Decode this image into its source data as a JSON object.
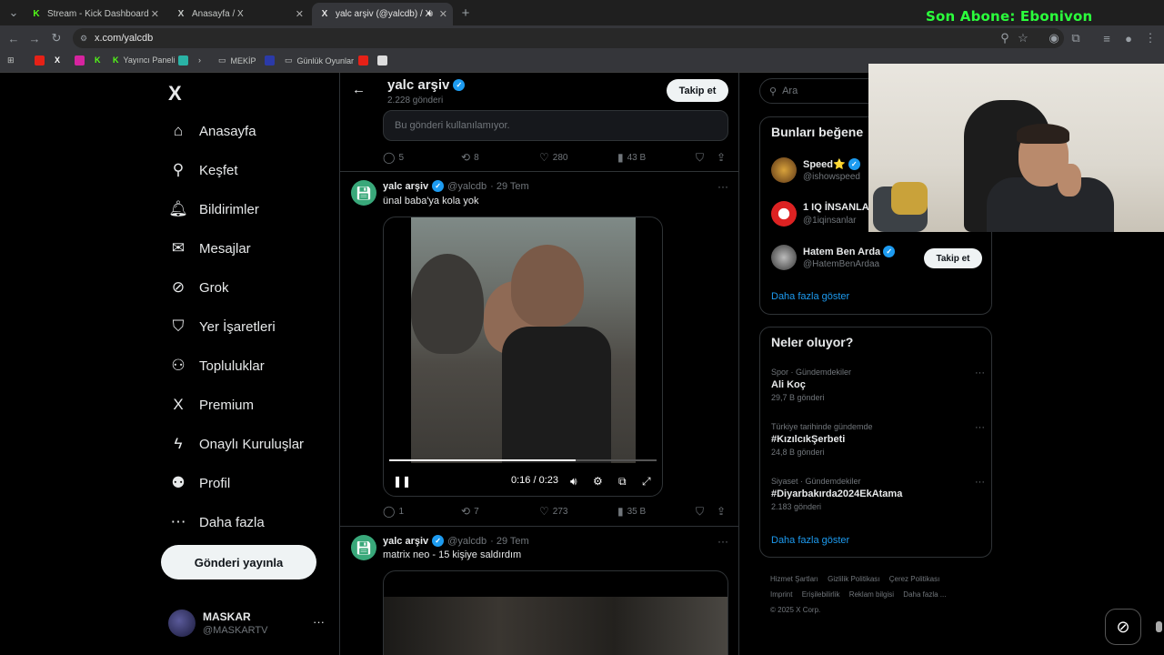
{
  "browser": {
    "tabs": [
      {
        "title": "Stream - Kick Dashboard",
        "icon": "kick-icon"
      },
      {
        "title": "Anasayfa / X",
        "icon": "x-icon"
      },
      {
        "title": "yalc arşiv (@yalcdb) / X",
        "icon": "x-icon"
      }
    ],
    "url": "x.com/yalcdb",
    "bookmarks": [
      "Yayıncı Paneli",
      "MEKİP",
      "Günlük Oyunlar"
    ],
    "overlay_text": "Son Abone: Ebonivon"
  },
  "nav": {
    "logo": "X",
    "items": [
      {
        "label": "Anasayfa",
        "icon": "home-icon",
        "glyph": "⌂"
      },
      {
        "label": "Keşfet",
        "icon": "search-icon",
        "glyph": "⚲"
      },
      {
        "label": "Bildirimler",
        "icon": "bell-icon",
        "glyph": "🔔︎"
      },
      {
        "label": "Mesajlar",
        "icon": "mail-icon",
        "glyph": "✉"
      },
      {
        "label": "Grok",
        "icon": "grok-icon",
        "glyph": "⊘"
      },
      {
        "label": "Yer İşaretleri",
        "icon": "bookmark-icon",
        "glyph": "⛉"
      },
      {
        "label": "Topluluklar",
        "icon": "communities-icon",
        "glyph": "⚇"
      },
      {
        "label": "Premium",
        "icon": "x-icon",
        "glyph": "X"
      },
      {
        "label": "Onaylı Kuruluşlar",
        "icon": "lightning-icon",
        "glyph": "ϟ"
      },
      {
        "label": "Profil",
        "icon": "profile-icon",
        "glyph": "⚉"
      },
      {
        "label": "Daha fazla",
        "icon": "more-circle-icon",
        "glyph": "⋯"
      }
    ],
    "post_button": "Gönderi yayınla",
    "account": {
      "name": "MASKAR",
      "handle": "@MASKARTV"
    }
  },
  "profile_header": {
    "name": "yalc arşiv",
    "posts": "2.228 gönderi",
    "follow": "Takip et"
  },
  "posts": [
    {
      "unavailable": "Bu gönderi kullanılamıyor.",
      "replies": "5",
      "reposts": "8",
      "likes": "280",
      "views": "43 B"
    },
    {
      "name": "yalc arşiv",
      "handle": "@yalcdb",
      "date": "· 29 Tem",
      "text": "ünal baba'ya kola yok",
      "video_time": "0:16 / 0:23",
      "progress": 0.696,
      "replies": "1",
      "reposts": "7",
      "likes": "273",
      "views": "35 B"
    },
    {
      "name": "yalc arşiv",
      "handle": "@yalcdb",
      "date": "· 29 Tem",
      "text": "matrix neo - 15 kişiye saldırdım"
    }
  ],
  "right": {
    "search_placeholder": "Ara",
    "who_title": "Bunları beğene",
    "who": [
      {
        "name": "Speed⭐",
        "handle": "@ishowspeed",
        "verified": true
      },
      {
        "name": "1 IQ İNSANLA",
        "handle": "@1iqinsanlar",
        "verified": false
      },
      {
        "name": "Hatem Ben Arda",
        "handle": "@HatemBenArdaa",
        "verified": true,
        "follow": "Takip et"
      }
    ],
    "who_more": "Daha fazla göster",
    "trends_title": "Neler oluyor?",
    "trends": [
      {
        "context": "Spor · Gündemdekiler",
        "name": "Ali Koç",
        "posts": "29,7 B gönderi"
      },
      {
        "context": "Türkiye tarihinde gündemde",
        "name": "#KızılcıkŞerbeti",
        "posts": "24,8 B gönderi"
      },
      {
        "context": "Siyaset · Gündemdekiler",
        "name": "#Diyarbakırda2024EkAtama",
        "posts": "2.183 gönderi"
      }
    ],
    "trends_more": "Daha fazla göster",
    "footer": [
      "Hizmet Şartları",
      "Gizlilik Politikası",
      "Çerez Politikası",
      "Imprint",
      "Erişilebilirlik",
      "Reklam bilgisi",
      "Daha fazla ...",
      "© 2025 X Corp."
    ]
  }
}
